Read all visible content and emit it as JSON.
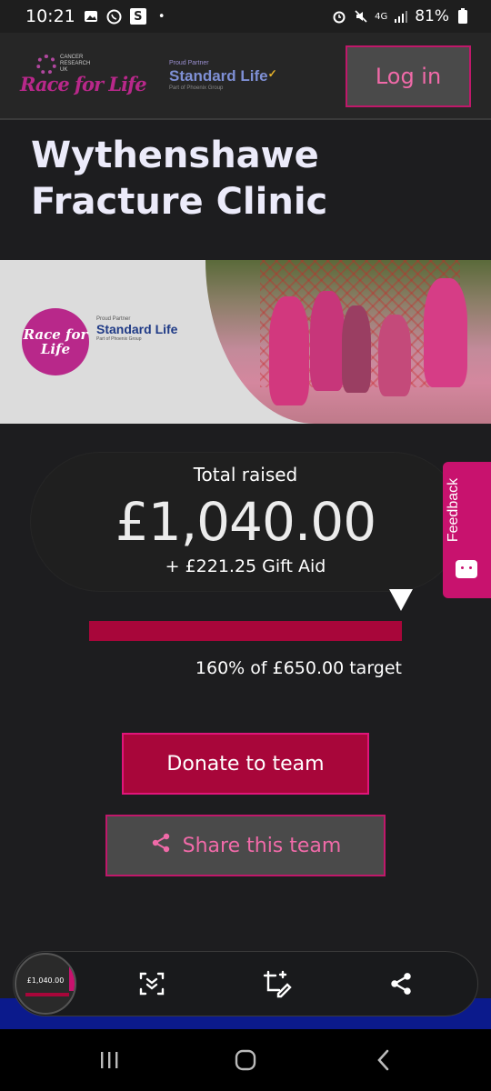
{
  "status_bar": {
    "time": "10:21",
    "battery": "81%",
    "network": "4G"
  },
  "header": {
    "logo_brand": "Race for Life",
    "logo_charity": "CANCER RESEARCH UK",
    "partner_label": "Proud Partner",
    "partner_name": "Standard Life",
    "partner_sub": "Part of Phoenix Group",
    "login_label": "Log in"
  },
  "page": {
    "title": "Wythenshawe Fracture Clinic"
  },
  "banner": {
    "brand": "Race for Life",
    "partner_label": "Proud Partner",
    "partner_name": "Standard Life",
    "partner_sub": "Part of Phoenix Group"
  },
  "fundraising": {
    "total_label": "Total raised",
    "total_amount": "£1,040.00",
    "gift_aid": "+ £221.25 Gift Aid",
    "progress_percent": 160,
    "target_text": "160% of £650.00 target"
  },
  "feedback": {
    "label": "Feedback"
  },
  "actions": {
    "donate_label": "Donate to team",
    "share_label": "Share this team"
  },
  "screenshot_toolbar": {
    "thumb_amount": "£1,040.00",
    "icons": [
      "scroll-capture-icon",
      "crop-edit-icon",
      "share-icon"
    ]
  },
  "colors": {
    "background": "#1d1d1f",
    "accent_pink": "#e0157a",
    "donate_red": "#a8063a",
    "progress_fill": "#a8063a"
  }
}
